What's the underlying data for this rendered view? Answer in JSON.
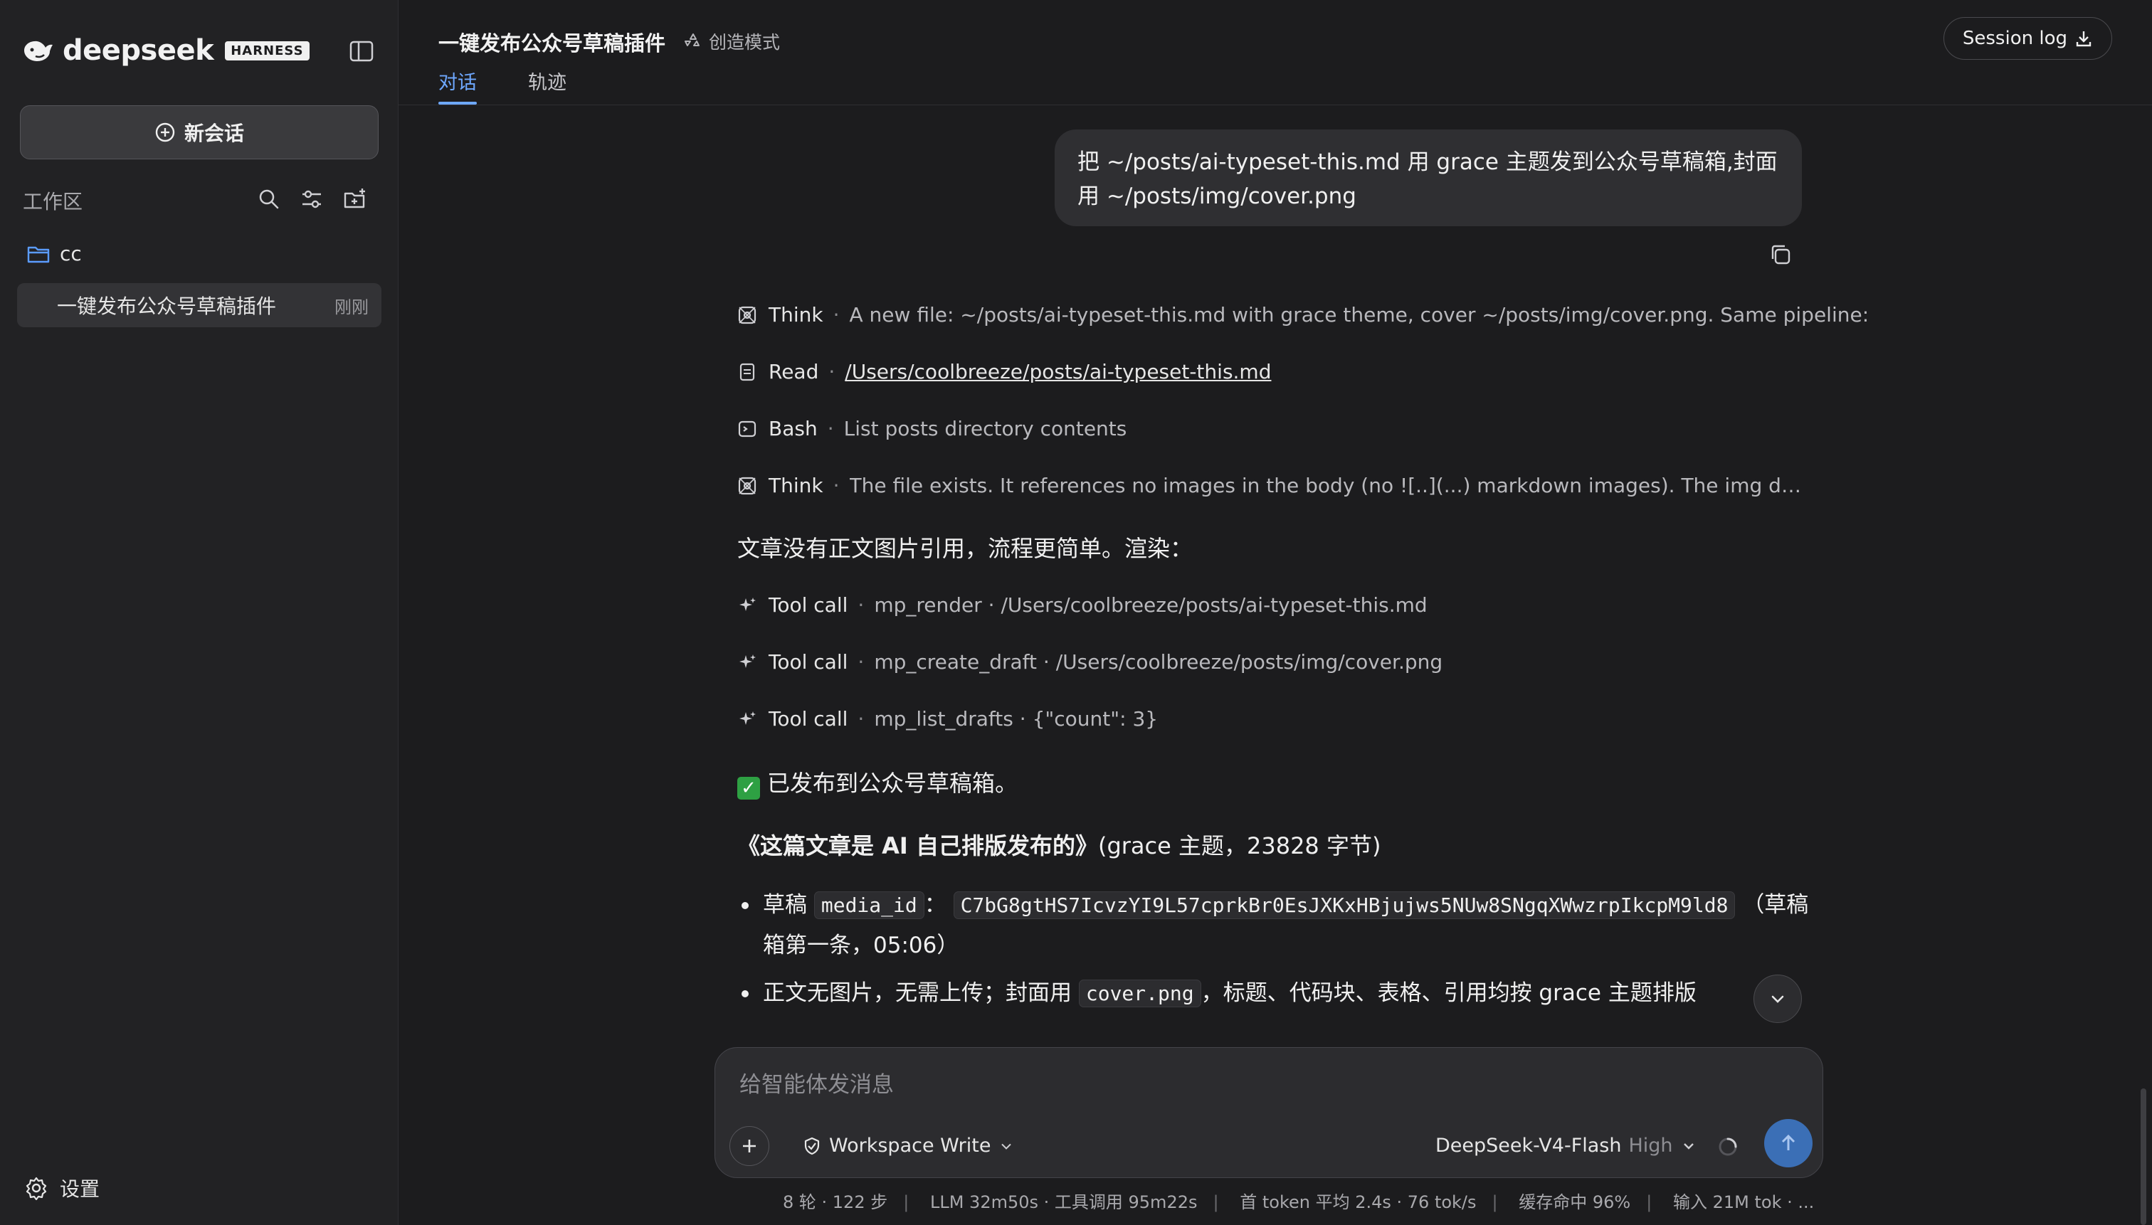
{
  "brand": {
    "name": "deepseek",
    "badge": "HARNESS"
  },
  "sidebar": {
    "new_chat_label": "新会话",
    "workspace_label": "工作区",
    "folder_name": "cc",
    "conversation": {
      "title": "一键发布公众号草稿插件",
      "time": "刚刚"
    },
    "settings_label": "设置"
  },
  "header": {
    "title": "一键发布公众号草稿插件",
    "mode": "创造模式",
    "tabs": [
      "对话",
      "轨迹"
    ],
    "session_log": "Session log"
  },
  "chat": {
    "user_message": "把 ~/posts/ai-typeset-this.md 用 grace 主题发到公众号草稿箱,封面用 ~/posts/img/cover.png",
    "steps": [
      {
        "icon": "think-icon",
        "kind": "Think",
        "detail": "A new file: ~/posts/ai-typeset-this.md with grace theme, cover ~/posts/img/cover.png. Same pipeline:"
      },
      {
        "icon": "file-icon",
        "kind": "Read",
        "detail": "/Users/coolbreeze/posts/ai-typeset-this.md"
      },
      {
        "icon": "terminal-icon",
        "kind": "Bash",
        "detail": "List posts directory contents"
      },
      {
        "icon": "think-icon",
        "kind": "Think",
        "detail": "The file exists. It references no images in the body (no ![..](...) markdown images). The img dir has cov..."
      }
    ],
    "para1": "文章没有正文图片引用，流程更简单。渲染：",
    "tool_calls": [
      {
        "kind": "Tool call",
        "detail": "mp_render · /Users/coolbreeze/posts/ai-typeset-this.md"
      },
      {
        "kind": "Tool call",
        "detail": "mp_create_draft · /Users/coolbreeze/posts/img/cover.png"
      },
      {
        "kind": "Tool call",
        "detail": "mp_list_drafts · {\"count\": 3}"
      }
    ],
    "published": "已发布到公众号草稿箱。",
    "article_title": "《这篇文章是 AI 自己排版发布的》",
    "article_meta": "(grace 主题，23828 字节)",
    "bullet1": {
      "prefix": "草稿",
      "code_key": "media_id",
      "colon": "：",
      "code_value": "C7bG8gtHS7IcvzYI9L57cprkBr0EsJXKxHBjujws5NUw8SNgqXWwzrpIkcpM9ld8",
      "suffix_line1": "（草稿",
      "suffix_line2": "箱第一条，05:06）"
    },
    "bullet2": {
      "prefix": "正文无图片，无需上传；封面用",
      "code": "cover.png",
      "suffix": "，标题、代码块、表格、引用均按 grace 主题排版"
    }
  },
  "composer": {
    "placeholder": "给智能体发消息",
    "permission": "Workspace Write",
    "model": "DeepSeek-V4-Flash",
    "level": "High"
  },
  "stats": [
    "8 轮 · 122 步",
    "LLM 32m50s · 工具调用 95m22s",
    "首 token 平均 2.4s · 76 tok/s",
    "缓存命中 96%",
    "输入 21M tok · ..."
  ]
}
